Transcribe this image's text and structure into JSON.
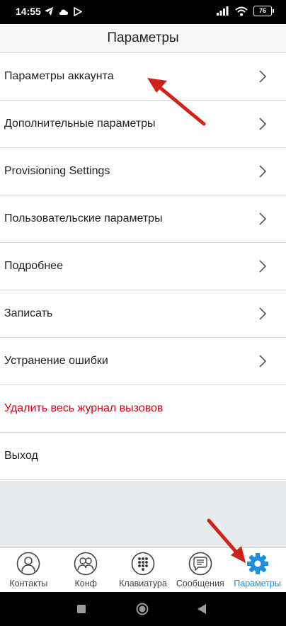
{
  "status_bar": {
    "time": "14:55",
    "battery": "76"
  },
  "header": {
    "title": "Параметры"
  },
  "menu": {
    "items": [
      {
        "label": "Параметры аккаунта",
        "chevron": true,
        "danger": false
      },
      {
        "label": "Дополнительные параметры",
        "chevron": true,
        "danger": false
      },
      {
        "label": "Provisioning Settings",
        "chevron": true,
        "danger": false
      },
      {
        "label": "Пользовательские параметры",
        "chevron": true,
        "danger": false
      },
      {
        "label": "Подробнее",
        "chevron": true,
        "danger": false
      },
      {
        "label": "Записать",
        "chevron": true,
        "danger": false
      },
      {
        "label": "Устранение ошибки",
        "chevron": true,
        "danger": false
      },
      {
        "label": "Удалить весь журнал вызовов",
        "chevron": false,
        "danger": true
      },
      {
        "label": "Выход",
        "chevron": false,
        "danger": false
      }
    ]
  },
  "tabs": [
    {
      "label": "Контакты",
      "icon": "contact-icon",
      "active": false
    },
    {
      "label": "Конф",
      "icon": "conference-icon",
      "active": false
    },
    {
      "label": "Клавиатура",
      "icon": "dialpad-icon",
      "active": false
    },
    {
      "label": "Сообщения",
      "icon": "message-icon",
      "active": false
    },
    {
      "label": "Параметры",
      "icon": "gear-icon",
      "active": true
    }
  ],
  "colors": {
    "accent": "#1b8fe0",
    "danger": "#d9001b",
    "annotation_arrow": "#d0211c"
  }
}
